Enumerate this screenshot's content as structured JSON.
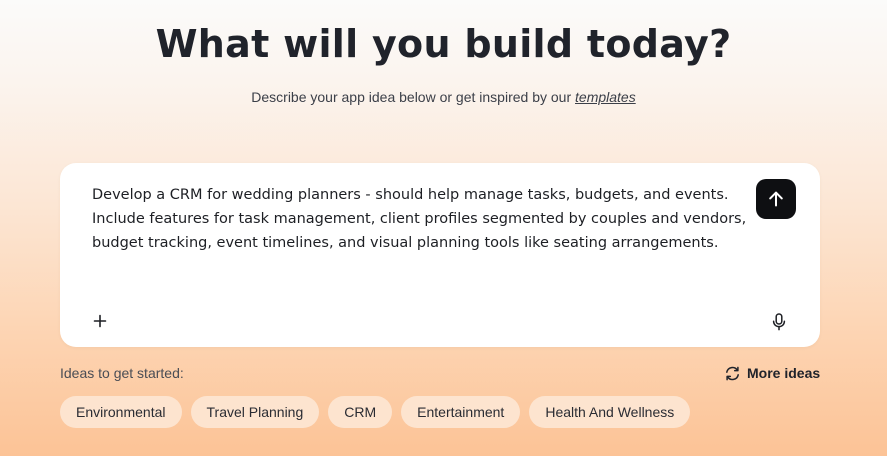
{
  "hero": {
    "title": "What will you build today?",
    "subtitle_text": "Describe your app idea below or get inspired by our ",
    "templates_link": "templates"
  },
  "prompt": {
    "value": "Develop a CRM for wedding planners - should help manage tasks, budgets, and events. Include features for task management, client profiles segmented by couples and vendors, budget tracking, event timelines, and visual planning tools like seating arrangements.",
    "send_icon": "arrow-up-icon",
    "add_icon": "plus-icon",
    "mic_icon": "microphone-icon"
  },
  "ideas": {
    "label": "Ideas to get started:",
    "more_label": "More ideas",
    "more_icon": "refresh-icon",
    "chips": [
      "Environmental",
      "Travel Planning",
      "CRM",
      "Entertainment",
      "Health And Wellness"
    ]
  },
  "colors": {
    "send_button": "#0e0f12",
    "chip_background": "#fde4cf",
    "heading": "#20232b",
    "gradient_bottom": "#fcc396"
  }
}
